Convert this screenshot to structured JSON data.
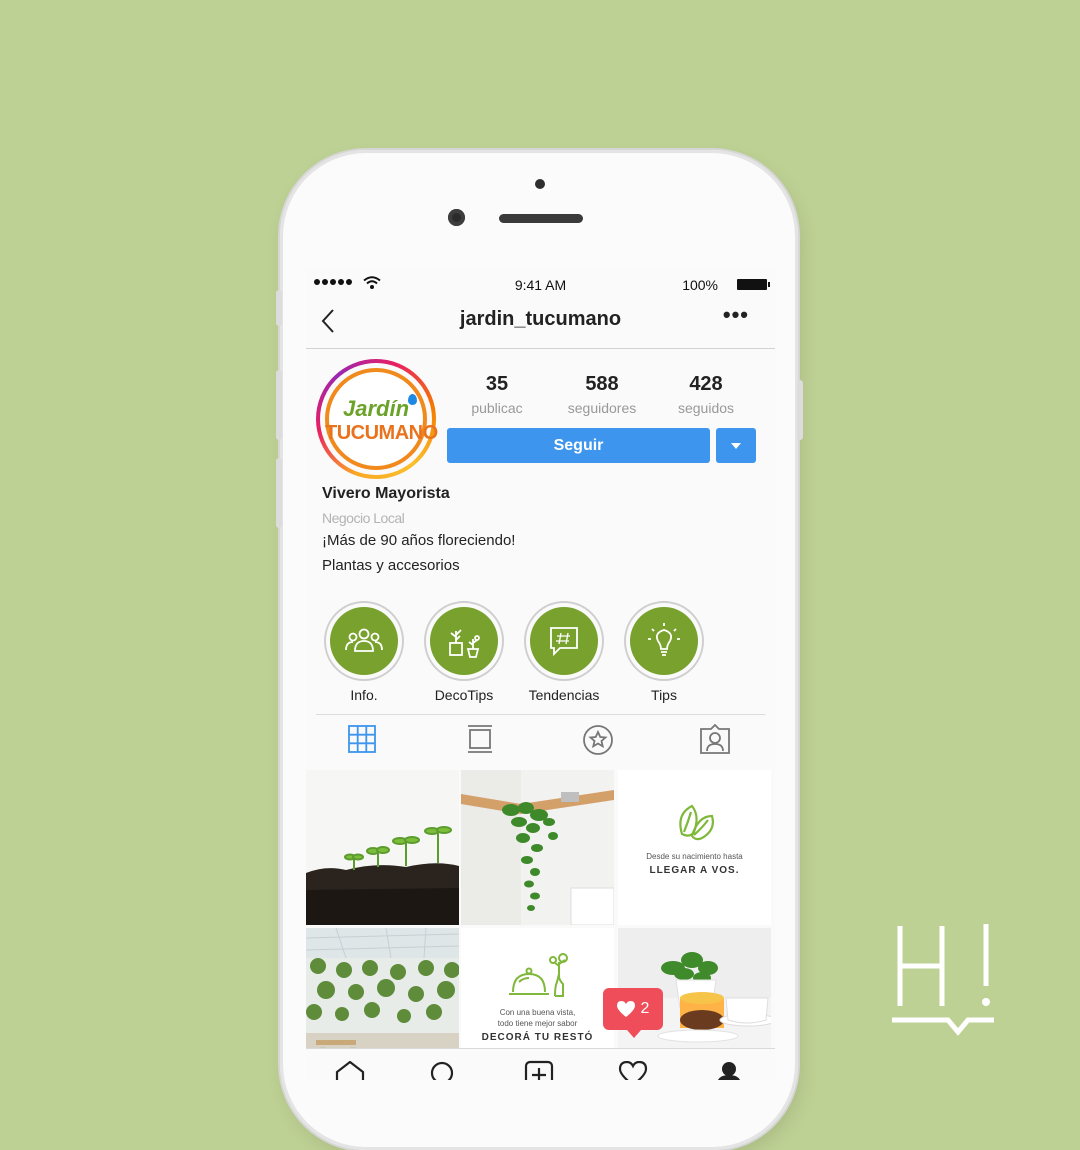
{
  "status": {
    "time": "9:41 AM",
    "battery": "100%"
  },
  "nav": {
    "back_icon": "chevron-left-icon",
    "handle": "jardin_tucumano",
    "more": "•••"
  },
  "logo": {
    "top": "Jardín",
    "bottom": "TUCUMANO"
  },
  "stats": [
    {
      "value": "35",
      "label": "publicac"
    },
    {
      "value": "588",
      "label": "seguidores"
    },
    {
      "value": "428",
      "label": "seguidos"
    }
  ],
  "follow": {
    "label": "Seguir"
  },
  "bio": {
    "name": "Vivero Mayorista",
    "category": "Negocio Local",
    "line1": "¡Más de 90 años floreciendo!",
    "line2": "Plantas y accesorios"
  },
  "highlights": [
    {
      "label": "Info.",
      "icon": "people-icon"
    },
    {
      "label": "DecoTips",
      "icon": "plants-icon"
    },
    {
      "label": "Tendencias",
      "icon": "hashtag-chat-icon"
    },
    {
      "label": "Tips",
      "icon": "lightbulb-icon"
    }
  ],
  "tabs": [
    "grid-icon",
    "feed-icon",
    "saved-icon",
    "tagged-icon"
  ],
  "posts": {
    "post3_line1": "Desde su nacimiento hasta",
    "post3_line2": "LLEGAR A VOS.",
    "post5_line1": "Con una buena vista,",
    "post5_line2": "todo tiene mejor sabor",
    "post5_line3": "DECORÁ TU RESTÓ"
  },
  "notification": {
    "count": "2"
  },
  "colors": {
    "background": "#bed194",
    "accent": "#3d95ee",
    "highlight": "#78a12d",
    "notification": "#ef4d5a"
  }
}
